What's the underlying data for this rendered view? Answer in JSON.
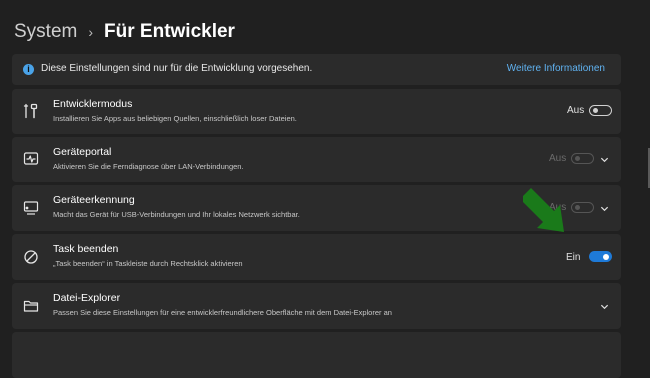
{
  "header": {
    "parent": "System",
    "current": "Für Entwickler"
  },
  "info": {
    "icon": "info-icon",
    "text": "Diese Einstellungen sind nur für die Entwicklung vorgesehen.",
    "link": "Weitere Informationen"
  },
  "rows": [
    {
      "icon": "developer-tools-icon",
      "title": "Entwicklermodus",
      "subtitle": "Installieren Sie Apps aus beliebigen Quellen, einschließlich loser Dateien.",
      "toggle_label": "Aus",
      "toggle_state": "off"
    },
    {
      "icon": "device-portal-icon",
      "title": "Geräteportal",
      "subtitle": "Aktivieren Sie die Ferndiagnose über LAN-Verbindungen.",
      "toggle_label": "Aus",
      "toggle_state": "disabled",
      "expandable": true
    },
    {
      "icon": "device-discovery-icon",
      "title": "Geräteerkennung",
      "subtitle": "Macht das Gerät für USB-Verbindungen und Ihr lokales Netzwerk sichtbar.",
      "toggle_label": "Aus",
      "toggle_state": "disabled",
      "expandable": true
    },
    {
      "icon": "end-task-icon",
      "title": "Task beenden",
      "subtitle": "„Task beenden“ in Taskleiste durch Rechtsklick aktivieren",
      "toggle_label": "Ein",
      "toggle_state": "on"
    },
    {
      "icon": "file-explorer-icon",
      "title": "Datei-Explorer",
      "subtitle": "Passen Sie diese Einstellungen für eine entwicklerfreundlichere Oberfläche mit dem Datei-Explorer an",
      "expandable": true
    }
  ],
  "annotation": {
    "icon": "arrow-pointer-icon",
    "color": "#1a7a1a"
  },
  "colors": {
    "accent": "#1e7ad8",
    "link": "#60b3f2",
    "card": "#2b2b2b",
    "background": "#202020"
  }
}
